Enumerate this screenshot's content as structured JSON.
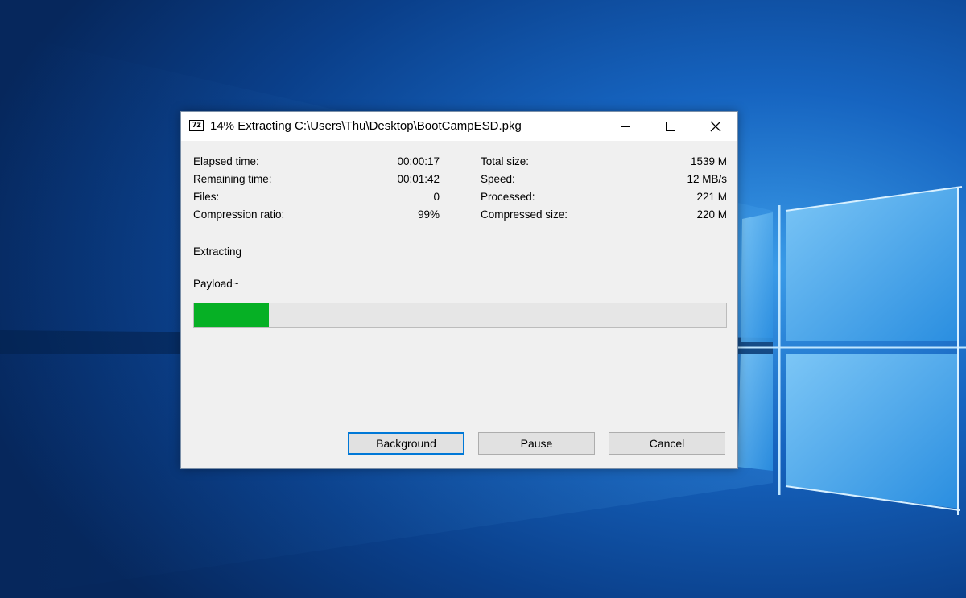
{
  "window": {
    "title": "14% Extracting C:\\Users\\Thu\\Desktop\\BootCampESD.pkg",
    "app_icon_text": "7z",
    "controls": {
      "minimize": "minimize-icon",
      "maximize": "maximize-icon",
      "close": "close-icon"
    }
  },
  "stats": {
    "left": [
      {
        "label": "Elapsed time:",
        "value": "00:00:17"
      },
      {
        "label": "Remaining time:",
        "value": "00:01:42"
      },
      {
        "label": "Files:",
        "value": "0"
      },
      {
        "label": "Compression ratio:",
        "value": "99%"
      }
    ],
    "right": [
      {
        "label": "Total size:",
        "value": "1539 M"
      },
      {
        "label": "Speed:",
        "value": "12 MB/s"
      },
      {
        "label": "Processed:",
        "value": "221 M"
      },
      {
        "label": "Compressed size:",
        "value": "220 M"
      }
    ]
  },
  "status": "Extracting",
  "current_file": "Payload~",
  "progress": {
    "percent": 14,
    "color": "#06b025"
  },
  "buttons": {
    "background": "Background",
    "pause": "Pause",
    "cancel": "Cancel"
  },
  "colors": {
    "accent": "#0078d7",
    "desktop": "#0a3f8a"
  }
}
